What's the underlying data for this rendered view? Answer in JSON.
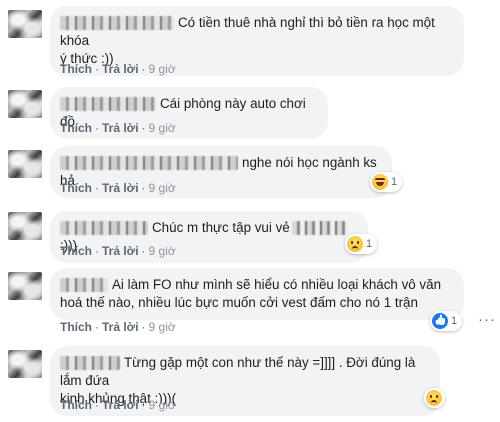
{
  "comments": [
    {
      "text_line1": "Có tiền thuê nhà nghỉ thì bỏ tiền ra học một khóa",
      "text_line2": "ý thức :))",
      "reply": "Trả lời",
      "like": "Thích",
      "time": "9 giờ"
    },
    {
      "text": "Cái phòng này auto chơi đồ",
      "reply": "Trả lời",
      "like": "Thích",
      "time": "9 giờ"
    },
    {
      "text": "nghe nói học ngành ks hả",
      "reply": "Trả lời",
      "like": "Thích",
      "time": "9 giờ",
      "reaction": {
        "icon": "haha-icon",
        "count": "1"
      }
    },
    {
      "text_before": "Chúc m thực tập vui vẻ",
      "text_after": ":)))",
      "reply": "Trả lời",
      "like": "Thích",
      "time": "9 giờ",
      "reaction": {
        "icon": "sad-icon",
        "count": "1"
      }
    },
    {
      "text_line1": "Ai làm FO như mình sẽ hiểu có nhiều loại khách vô văn",
      "text_line2": "hoá thế nào, nhiều lúc bực muốn cởi vest đấm cho nó 1 trận",
      "reply": "Trả lời",
      "like": "Thích",
      "time": "9 giờ",
      "reaction": {
        "icon": "like-icon",
        "count": "1"
      }
    },
    {
      "text_line1": "Từng gặp một con như thế này =]]]] . Đời đúng là lắm đứa",
      "text_line2": "kinh khủng thật :)))(",
      "reply": "Trả lời",
      "like": "Thích",
      "time": "9 giờ",
      "reaction": {
        "icon": "sad-icon"
      }
    }
  ],
  "colors": {
    "bubble": "#f2f3f5",
    "meta": "#606770",
    "like_blue": "#1877f2"
  },
  "more_icon": "more-options-icon"
}
